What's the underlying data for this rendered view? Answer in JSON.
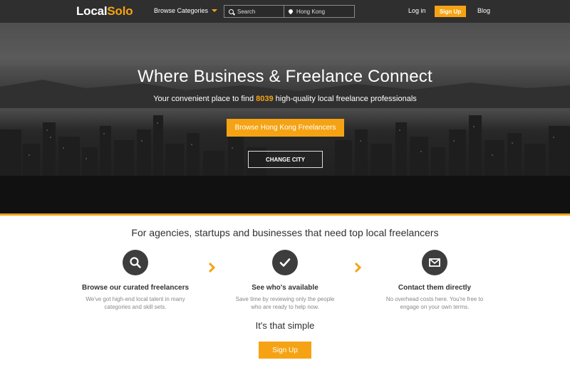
{
  "header": {
    "logo_part1": "Local",
    "logo_part2": "Solo",
    "browse_label": "Browse Categories",
    "search_placeholder": "Search",
    "location_value": "Hong Kong",
    "login_label": "Log in",
    "signup_label": "Sign Up",
    "blog_label": "Blog"
  },
  "hero": {
    "title": "Where Business & Freelance Connect",
    "tagline_prefix": "Your convenient place to find ",
    "tagline_count": "8039",
    "tagline_suffix": " high-quality local freelance professionals",
    "browse_button": "Browse Hong Kong Freelancers",
    "change_city_button": "CHANGE CITY"
  },
  "features": {
    "title": "For agencies, startups and businesses that need top local freelancers",
    "steps": [
      {
        "icon": "search-icon",
        "heading": "Browse our curated freelancers",
        "text_line1": "We've got high-end local talent in many",
        "text_line2": "categories and skill sets."
      },
      {
        "icon": "check-icon",
        "heading": "See who's available",
        "text_line1": "Save time by reviewing only the people",
        "text_line2": "who are ready to help now."
      },
      {
        "icon": "mail-icon",
        "heading": "Contact them directly",
        "text_line1": "No overhead costs here. You're free to",
        "text_line2": "engage on your own terms."
      }
    ],
    "simple_label": "It's that simple",
    "signup_label": "Sign Up"
  },
  "colors": {
    "accent": "#f5a314",
    "header_bg": "#2f2f2f",
    "icon_circle": "#3d3d3d"
  }
}
